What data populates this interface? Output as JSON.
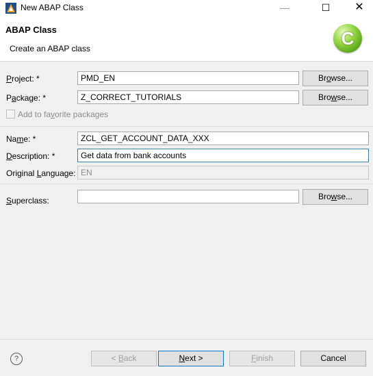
{
  "window": {
    "title": "New ABAP Class",
    "minimize_glyph": "—",
    "maximize_glyph": "☐",
    "close_glyph": "✕"
  },
  "banner": {
    "title": "ABAP Class",
    "subtitle": "Create an ABAP class",
    "logo_letter": "C"
  },
  "fields": {
    "project": {
      "label_pre": "",
      "label_key": "P",
      "label_post": "roject: *",
      "value": "PMD_EN"
    },
    "package": {
      "label_pre": "P",
      "label_key": "a",
      "label_post": "ckage: *",
      "value": "Z_CORRECT_TUTORIALS"
    },
    "favorite": {
      "label_pre": "Add to fa",
      "label_key": "v",
      "label_post": "orite packages",
      "checked": false
    },
    "name": {
      "label_pre": "Na",
      "label_key": "m",
      "label_post": "e: *",
      "value": "ZCL_GET_ACCOUNT_DATA_XXX"
    },
    "description": {
      "label_pre": "",
      "label_key": "D",
      "label_post": "escription: *",
      "value": "Get data from bank accounts"
    },
    "original_language": {
      "label_pre": "Original ",
      "label_key": "L",
      "label_post": "anguage:",
      "value": "EN"
    },
    "superclass": {
      "label_pre": "",
      "label_key": "S",
      "label_post": "uperclass:",
      "value": ""
    }
  },
  "browse_buttons": {
    "project": {
      "pre": "Br",
      "key": "o",
      "post": "wse..."
    },
    "package": {
      "pre": "Bro",
      "key": "w",
      "post": "se..."
    },
    "superclass": {
      "pre": "Bro",
      "key": "w",
      "post": "se..."
    }
  },
  "footer": {
    "help_glyph": "?",
    "back": {
      "pre": "< ",
      "key": "B",
      "post": "ack"
    },
    "next": {
      "pre": "",
      "key": "N",
      "post": "ext >"
    },
    "finish": {
      "pre": "",
      "key": "F",
      "post": "inish"
    },
    "cancel": "Cancel"
  },
  "colors": {
    "accent_border": "#0078d7",
    "focus_border": "#3c7fb1",
    "logo_green": "#5aa819"
  }
}
